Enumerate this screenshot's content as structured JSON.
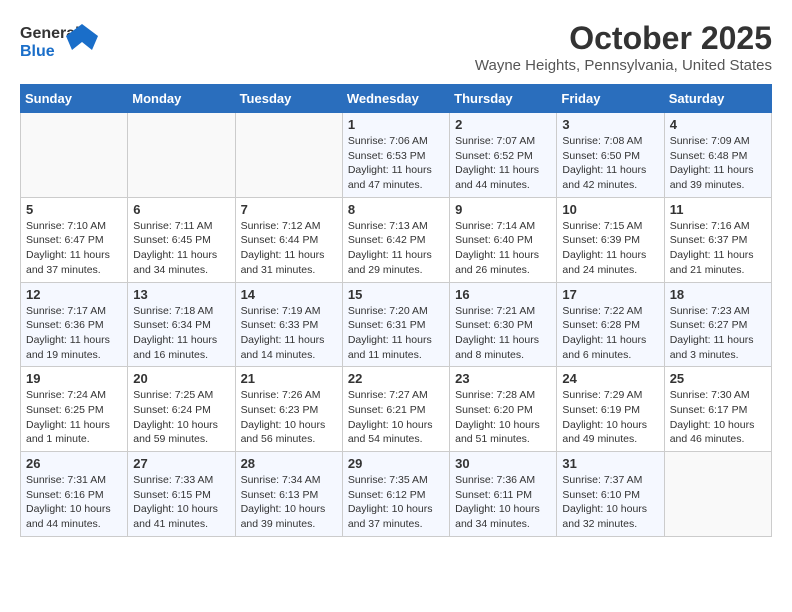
{
  "header": {
    "logo_line1": "General",
    "logo_line2": "Blue",
    "month": "October 2025",
    "location": "Wayne Heights, Pennsylvania, United States"
  },
  "weekdays": [
    "Sunday",
    "Monday",
    "Tuesday",
    "Wednesday",
    "Thursday",
    "Friday",
    "Saturday"
  ],
  "weeks": [
    [
      {
        "day": "",
        "info": ""
      },
      {
        "day": "",
        "info": ""
      },
      {
        "day": "",
        "info": ""
      },
      {
        "day": "1",
        "info": "Sunrise: 7:06 AM\nSunset: 6:53 PM\nDaylight: 11 hours and 47 minutes."
      },
      {
        "day": "2",
        "info": "Sunrise: 7:07 AM\nSunset: 6:52 PM\nDaylight: 11 hours and 44 minutes."
      },
      {
        "day": "3",
        "info": "Sunrise: 7:08 AM\nSunset: 6:50 PM\nDaylight: 11 hours and 42 minutes."
      },
      {
        "day": "4",
        "info": "Sunrise: 7:09 AM\nSunset: 6:48 PM\nDaylight: 11 hours and 39 minutes."
      }
    ],
    [
      {
        "day": "5",
        "info": "Sunrise: 7:10 AM\nSunset: 6:47 PM\nDaylight: 11 hours and 37 minutes."
      },
      {
        "day": "6",
        "info": "Sunrise: 7:11 AM\nSunset: 6:45 PM\nDaylight: 11 hours and 34 minutes."
      },
      {
        "day": "7",
        "info": "Sunrise: 7:12 AM\nSunset: 6:44 PM\nDaylight: 11 hours and 31 minutes."
      },
      {
        "day": "8",
        "info": "Sunrise: 7:13 AM\nSunset: 6:42 PM\nDaylight: 11 hours and 29 minutes."
      },
      {
        "day": "9",
        "info": "Sunrise: 7:14 AM\nSunset: 6:40 PM\nDaylight: 11 hours and 26 minutes."
      },
      {
        "day": "10",
        "info": "Sunrise: 7:15 AM\nSunset: 6:39 PM\nDaylight: 11 hours and 24 minutes."
      },
      {
        "day": "11",
        "info": "Sunrise: 7:16 AM\nSunset: 6:37 PM\nDaylight: 11 hours and 21 minutes."
      }
    ],
    [
      {
        "day": "12",
        "info": "Sunrise: 7:17 AM\nSunset: 6:36 PM\nDaylight: 11 hours and 19 minutes."
      },
      {
        "day": "13",
        "info": "Sunrise: 7:18 AM\nSunset: 6:34 PM\nDaylight: 11 hours and 16 minutes."
      },
      {
        "day": "14",
        "info": "Sunrise: 7:19 AM\nSunset: 6:33 PM\nDaylight: 11 hours and 14 minutes."
      },
      {
        "day": "15",
        "info": "Sunrise: 7:20 AM\nSunset: 6:31 PM\nDaylight: 11 hours and 11 minutes."
      },
      {
        "day": "16",
        "info": "Sunrise: 7:21 AM\nSunset: 6:30 PM\nDaylight: 11 hours and 8 minutes."
      },
      {
        "day": "17",
        "info": "Sunrise: 7:22 AM\nSunset: 6:28 PM\nDaylight: 11 hours and 6 minutes."
      },
      {
        "day": "18",
        "info": "Sunrise: 7:23 AM\nSunset: 6:27 PM\nDaylight: 11 hours and 3 minutes."
      }
    ],
    [
      {
        "day": "19",
        "info": "Sunrise: 7:24 AM\nSunset: 6:25 PM\nDaylight: 11 hours and 1 minute."
      },
      {
        "day": "20",
        "info": "Sunrise: 7:25 AM\nSunset: 6:24 PM\nDaylight: 10 hours and 59 minutes."
      },
      {
        "day": "21",
        "info": "Sunrise: 7:26 AM\nSunset: 6:23 PM\nDaylight: 10 hours and 56 minutes."
      },
      {
        "day": "22",
        "info": "Sunrise: 7:27 AM\nSunset: 6:21 PM\nDaylight: 10 hours and 54 minutes."
      },
      {
        "day": "23",
        "info": "Sunrise: 7:28 AM\nSunset: 6:20 PM\nDaylight: 10 hours and 51 minutes."
      },
      {
        "day": "24",
        "info": "Sunrise: 7:29 AM\nSunset: 6:19 PM\nDaylight: 10 hours and 49 minutes."
      },
      {
        "day": "25",
        "info": "Sunrise: 7:30 AM\nSunset: 6:17 PM\nDaylight: 10 hours and 46 minutes."
      }
    ],
    [
      {
        "day": "26",
        "info": "Sunrise: 7:31 AM\nSunset: 6:16 PM\nDaylight: 10 hours and 44 minutes."
      },
      {
        "day": "27",
        "info": "Sunrise: 7:33 AM\nSunset: 6:15 PM\nDaylight: 10 hours and 41 minutes."
      },
      {
        "day": "28",
        "info": "Sunrise: 7:34 AM\nSunset: 6:13 PM\nDaylight: 10 hours and 39 minutes."
      },
      {
        "day": "29",
        "info": "Sunrise: 7:35 AM\nSunset: 6:12 PM\nDaylight: 10 hours and 37 minutes."
      },
      {
        "day": "30",
        "info": "Sunrise: 7:36 AM\nSunset: 6:11 PM\nDaylight: 10 hours and 34 minutes."
      },
      {
        "day": "31",
        "info": "Sunrise: 7:37 AM\nSunset: 6:10 PM\nDaylight: 10 hours and 32 minutes."
      },
      {
        "day": "",
        "info": ""
      }
    ]
  ]
}
